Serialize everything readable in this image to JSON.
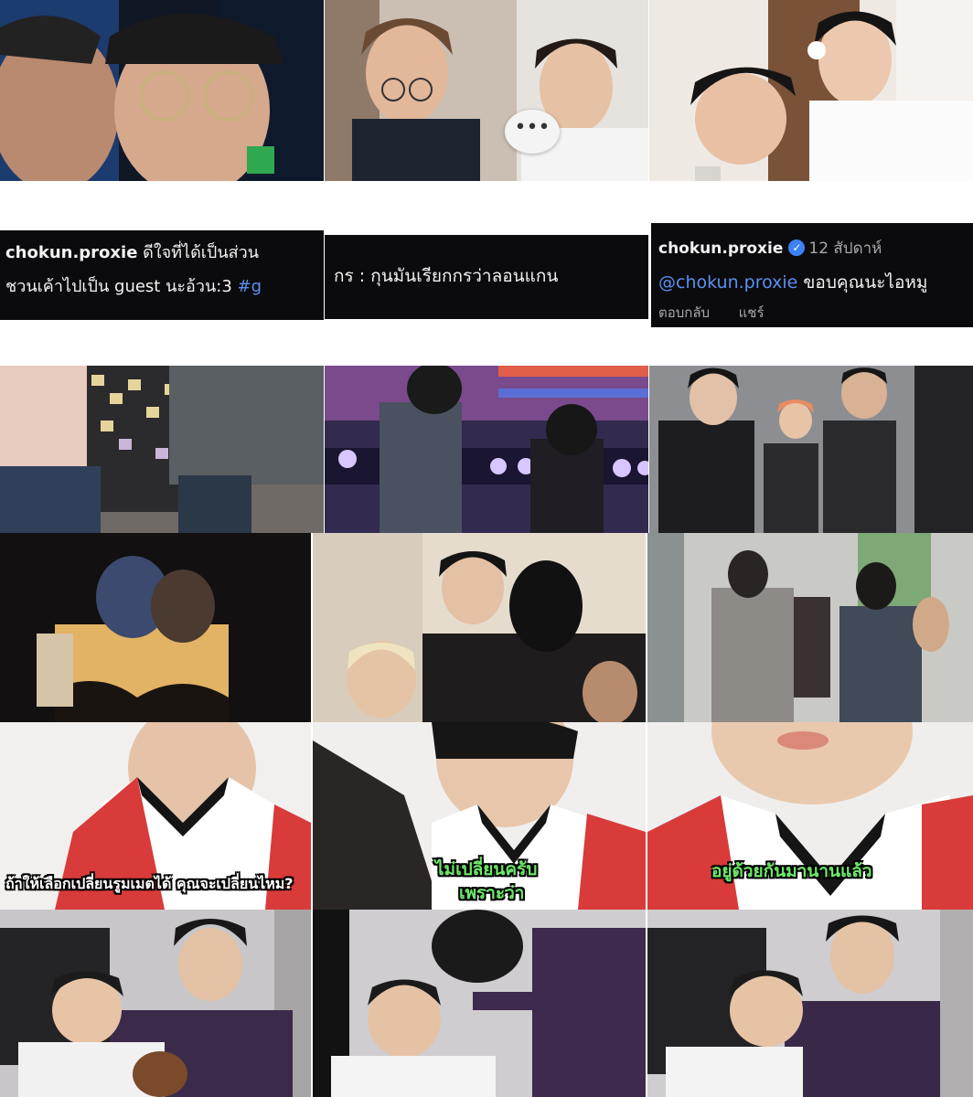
{
  "comments": {
    "c1": {
      "username": "chokun.proxie",
      "line1": "ดีใจที่ได้เป็นส่วน",
      "line2_text": "ชวนเค้าไปเป็น guest นะอ้วน:3 ",
      "line2_tag": "#g"
    },
    "c2": {
      "text": "กร : กุนมันเรียกกรว่าลอนแกน "
    },
    "c3": {
      "username": "chokun.proxie",
      "time": "12 สัปดาห์",
      "mention": "@chokun.proxie",
      "text": " ขอบคุณนะไอหมู",
      "reply": "ตอบกลับ",
      "share": "แชร์"
    }
  },
  "captions": {
    "cap1": "ถ้าให้เลือกเปลี่ยนรูมเมตได้ คุณจะเปลี่ยนไหม?",
    "cap2_line1": "ไม่เปลี่ยนครับ",
    "cap2_line2": "เพราะว่า",
    "cap3": "อยู่ด้วยกันมานานแล้ว"
  },
  "icons": {
    "typing_bubble": "ellipsis-bubble-icon",
    "verified": "verified-badge-icon"
  },
  "colors": {
    "strip_bg": "#0b0b0d",
    "link": "#5b8ff0",
    "caption_green": "#6ee86a"
  }
}
